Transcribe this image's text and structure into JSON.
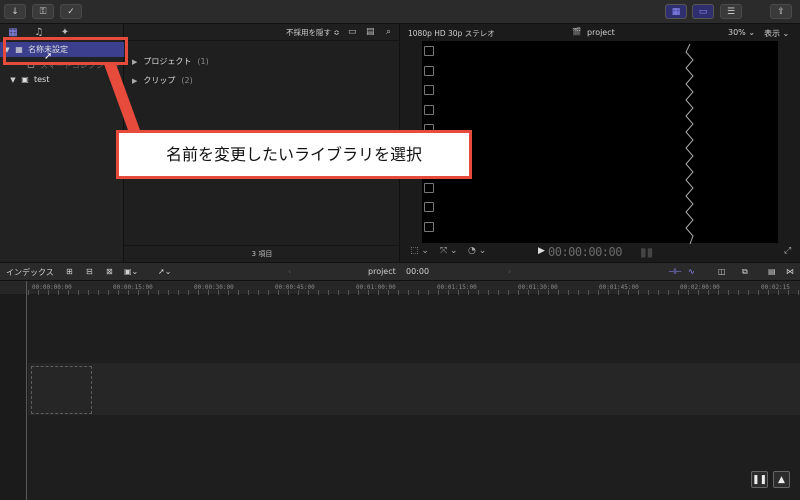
{
  "toolbar": {
    "import_icon": "down-arrow-icon",
    "keyword_icon": "key-icon",
    "check_icon": "checkmark-circle-icon",
    "share_icon": "share-icon",
    "accent": "#8f8fff"
  },
  "library": {
    "items": [
      {
        "label": "名称未設定",
        "selected": true
      },
      {
        "label": "スマートコレクション"
      },
      {
        "label": "test"
      }
    ]
  },
  "browser": {
    "filter_label": "不採用を隠す ≎",
    "groups": [
      {
        "label": "プロジェクト",
        "count": "(1)"
      },
      {
        "label": "クリップ",
        "count": "(2)"
      }
    ],
    "footer": "3 項目"
  },
  "viewer": {
    "format": "1080p HD 30p ステレオ",
    "project": "project",
    "zoom": "30%",
    "display": "表示",
    "timecode": "00:00:00:00"
  },
  "timeline": {
    "index_label": "インデックス",
    "project_name": "project",
    "position": "00:00",
    "ruler": [
      "00:00:00:00",
      "00:00:15:00",
      "00:00:30:00",
      "00:00:45:00",
      "00:01:00:00",
      "00:01:15:00",
      "00:01:30:00",
      "00:01:45:00",
      "00:02:00:00",
      "00:02:15"
    ]
  },
  "annotation": {
    "callout_text": "名前を変更したいライブラリを選択",
    "color": "#e74b3c"
  }
}
